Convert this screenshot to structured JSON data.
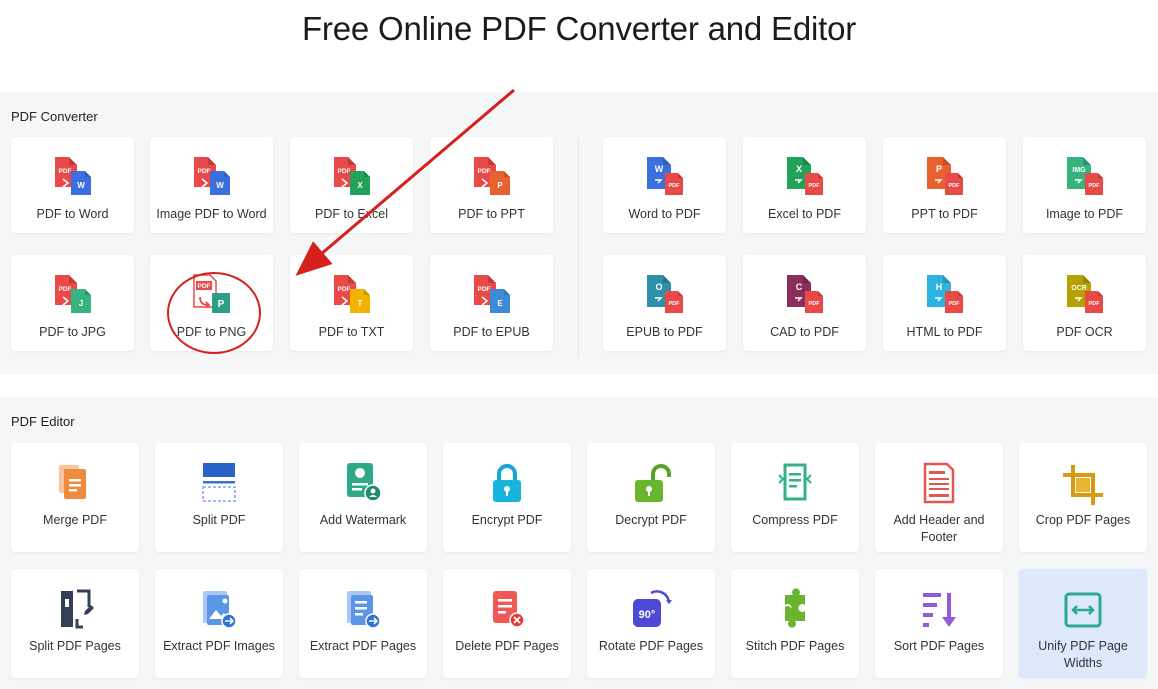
{
  "title": "Free Online PDF Converter and Editor",
  "converter": {
    "label": "PDF Converter",
    "left": [
      {
        "label": "PDF to Word",
        "icon": "pdf-to-word-icon"
      },
      {
        "label": "Image PDF to Word",
        "icon": "image-pdf-to-word-icon"
      },
      {
        "label": "PDF to Excel",
        "icon": "pdf-to-excel-icon"
      },
      {
        "label": "PDF to PPT",
        "icon": "pdf-to-ppt-icon"
      },
      {
        "label": "PDF to JPG",
        "icon": "pdf-to-jpg-icon"
      },
      {
        "label": "PDF to PNG",
        "icon": "pdf-to-png-icon"
      },
      {
        "label": "PDF to TXT",
        "icon": "pdf-to-txt-icon"
      },
      {
        "label": "PDF to EPUB",
        "icon": "pdf-to-epub-icon"
      }
    ],
    "right": [
      {
        "label": "Word to PDF",
        "icon": "word-to-pdf-icon"
      },
      {
        "label": "Excel to PDF",
        "icon": "excel-to-pdf-icon"
      },
      {
        "label": "PPT to PDF",
        "icon": "ppt-to-pdf-icon"
      },
      {
        "label": "Image to PDF",
        "icon": "image-to-pdf-icon"
      },
      {
        "label": "EPUB to PDF",
        "icon": "epub-to-pdf-icon"
      },
      {
        "label": "CAD to PDF",
        "icon": "cad-to-pdf-icon"
      },
      {
        "label": "HTML to PDF",
        "icon": "html-to-pdf-icon"
      },
      {
        "label": "PDF OCR",
        "icon": "pdf-ocr-icon"
      }
    ]
  },
  "editor": {
    "label": "PDF Editor",
    "items": [
      {
        "label": "Merge PDF",
        "icon": "merge-pdf-icon"
      },
      {
        "label": "Split PDF",
        "icon": "split-pdf-icon"
      },
      {
        "label": "Add Watermark",
        "icon": "add-watermark-icon"
      },
      {
        "label": "Encrypt PDF",
        "icon": "encrypt-pdf-icon"
      },
      {
        "label": "Decrypt PDF",
        "icon": "decrypt-pdf-icon"
      },
      {
        "label": "Compress PDF",
        "icon": "compress-pdf-icon"
      },
      {
        "label": "Add Header and Footer",
        "icon": "add-header-footer-icon"
      },
      {
        "label": "Crop PDF Pages",
        "icon": "crop-pdf-pages-icon"
      },
      {
        "label": "Split PDF Pages",
        "icon": "split-pdf-pages-icon"
      },
      {
        "label": "Extract PDF Images",
        "icon": "extract-pdf-images-icon"
      },
      {
        "label": "Extract PDF Pages",
        "icon": "extract-pdf-pages-icon"
      },
      {
        "label": "Delete PDF Pages",
        "icon": "delete-pdf-pages-icon"
      },
      {
        "label": "Rotate PDF Pages",
        "icon": "rotate-pdf-pages-icon"
      },
      {
        "label": "Stitch PDF Pages",
        "icon": "stitch-pdf-pages-icon"
      },
      {
        "label": "Sort PDF Pages",
        "icon": "sort-pdf-pages-icon"
      },
      {
        "label": "Unify PDF Page Widths",
        "icon": "unify-pdf-page-widths-icon"
      }
    ]
  },
  "icon_text": {
    "pdf": "PDF",
    "w": "W",
    "x": "X",
    "p": "P",
    "j": "J",
    "t": "T",
    "e": "E",
    "o": "O",
    "c": "C",
    "h": "H",
    "img": "IMG",
    "ocr": "OCR",
    "rot": "90°"
  },
  "colors": {
    "pdf_red": "#ea4a47",
    "word_blue": "#3b6fe0",
    "excel_green": "#21a35b",
    "ppt_orange": "#e8622f",
    "jpg_green": "#36b37e",
    "png_teal": "#2f9e86",
    "txt_yellow": "#f0b400",
    "epub_blue": "#3d8bd8",
    "epub_teal": "#2f8ea8",
    "cad_purple": "#8b2e5b",
    "html_cyan": "#2cb3e0",
    "ocr_olive": "#b3a300",
    "accent_red": "#d6201e",
    "active_bg": "#dde9fb"
  }
}
